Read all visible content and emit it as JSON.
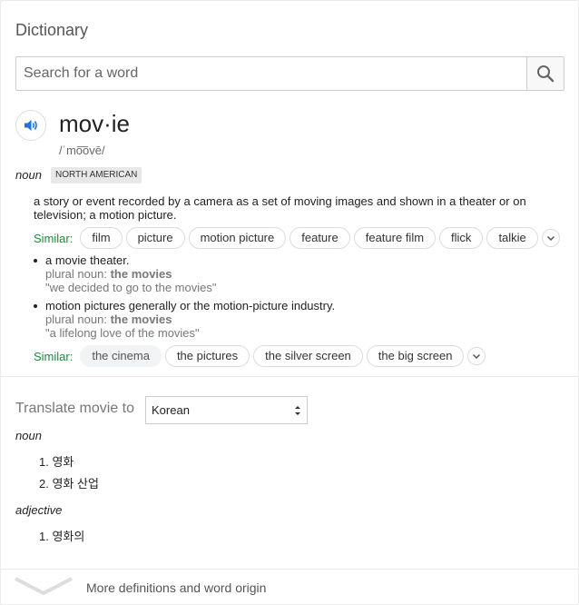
{
  "header": {
    "title": "Dictionary"
  },
  "search": {
    "placeholder": "Search for a word",
    "value": ""
  },
  "entry": {
    "headword": "mov·ie",
    "pronunciation": "/ˈmo͞ovē/",
    "part_of_speech": "noun",
    "region_badge": "NORTH AMERICAN",
    "definition": "a story or event recorded by a camera as a set of moving images and shown in a theater or on television; a motion picture.",
    "similar_label": "Similar:",
    "similar": [
      "film",
      "picture",
      "motion picture",
      "feature",
      "feature film",
      "flick",
      "talkie"
    ],
    "senses": [
      {
        "text": "a movie theater.",
        "plural_label": "plural noun:",
        "plural": "the movies",
        "example": "\"we decided to go to the movies\""
      },
      {
        "text": "motion pictures generally or the motion-picture industry.",
        "plural_label": "plural noun:",
        "plural": "the movies",
        "example": "\"a lifelong love of the movies\""
      }
    ],
    "similar2": [
      "the cinema",
      "the pictures",
      "the silver screen",
      "the big screen"
    ]
  },
  "translate": {
    "label": "Translate movie to",
    "language": "Korean",
    "groups": [
      {
        "pos": "noun",
        "items": [
          "1. 영화",
          "2. 영화 산업"
        ]
      },
      {
        "pos": "adjective",
        "items": [
          "1. 영화의"
        ]
      }
    ]
  },
  "footer": {
    "more_label": "More definitions and word origin"
  },
  "colors": {
    "similar_green": "#1a8c3a",
    "speaker_blue": "#1a73e8"
  },
  "icons": {
    "search": "search-icon",
    "speaker": "speaker-icon",
    "expand": "chevron-down-icon"
  }
}
